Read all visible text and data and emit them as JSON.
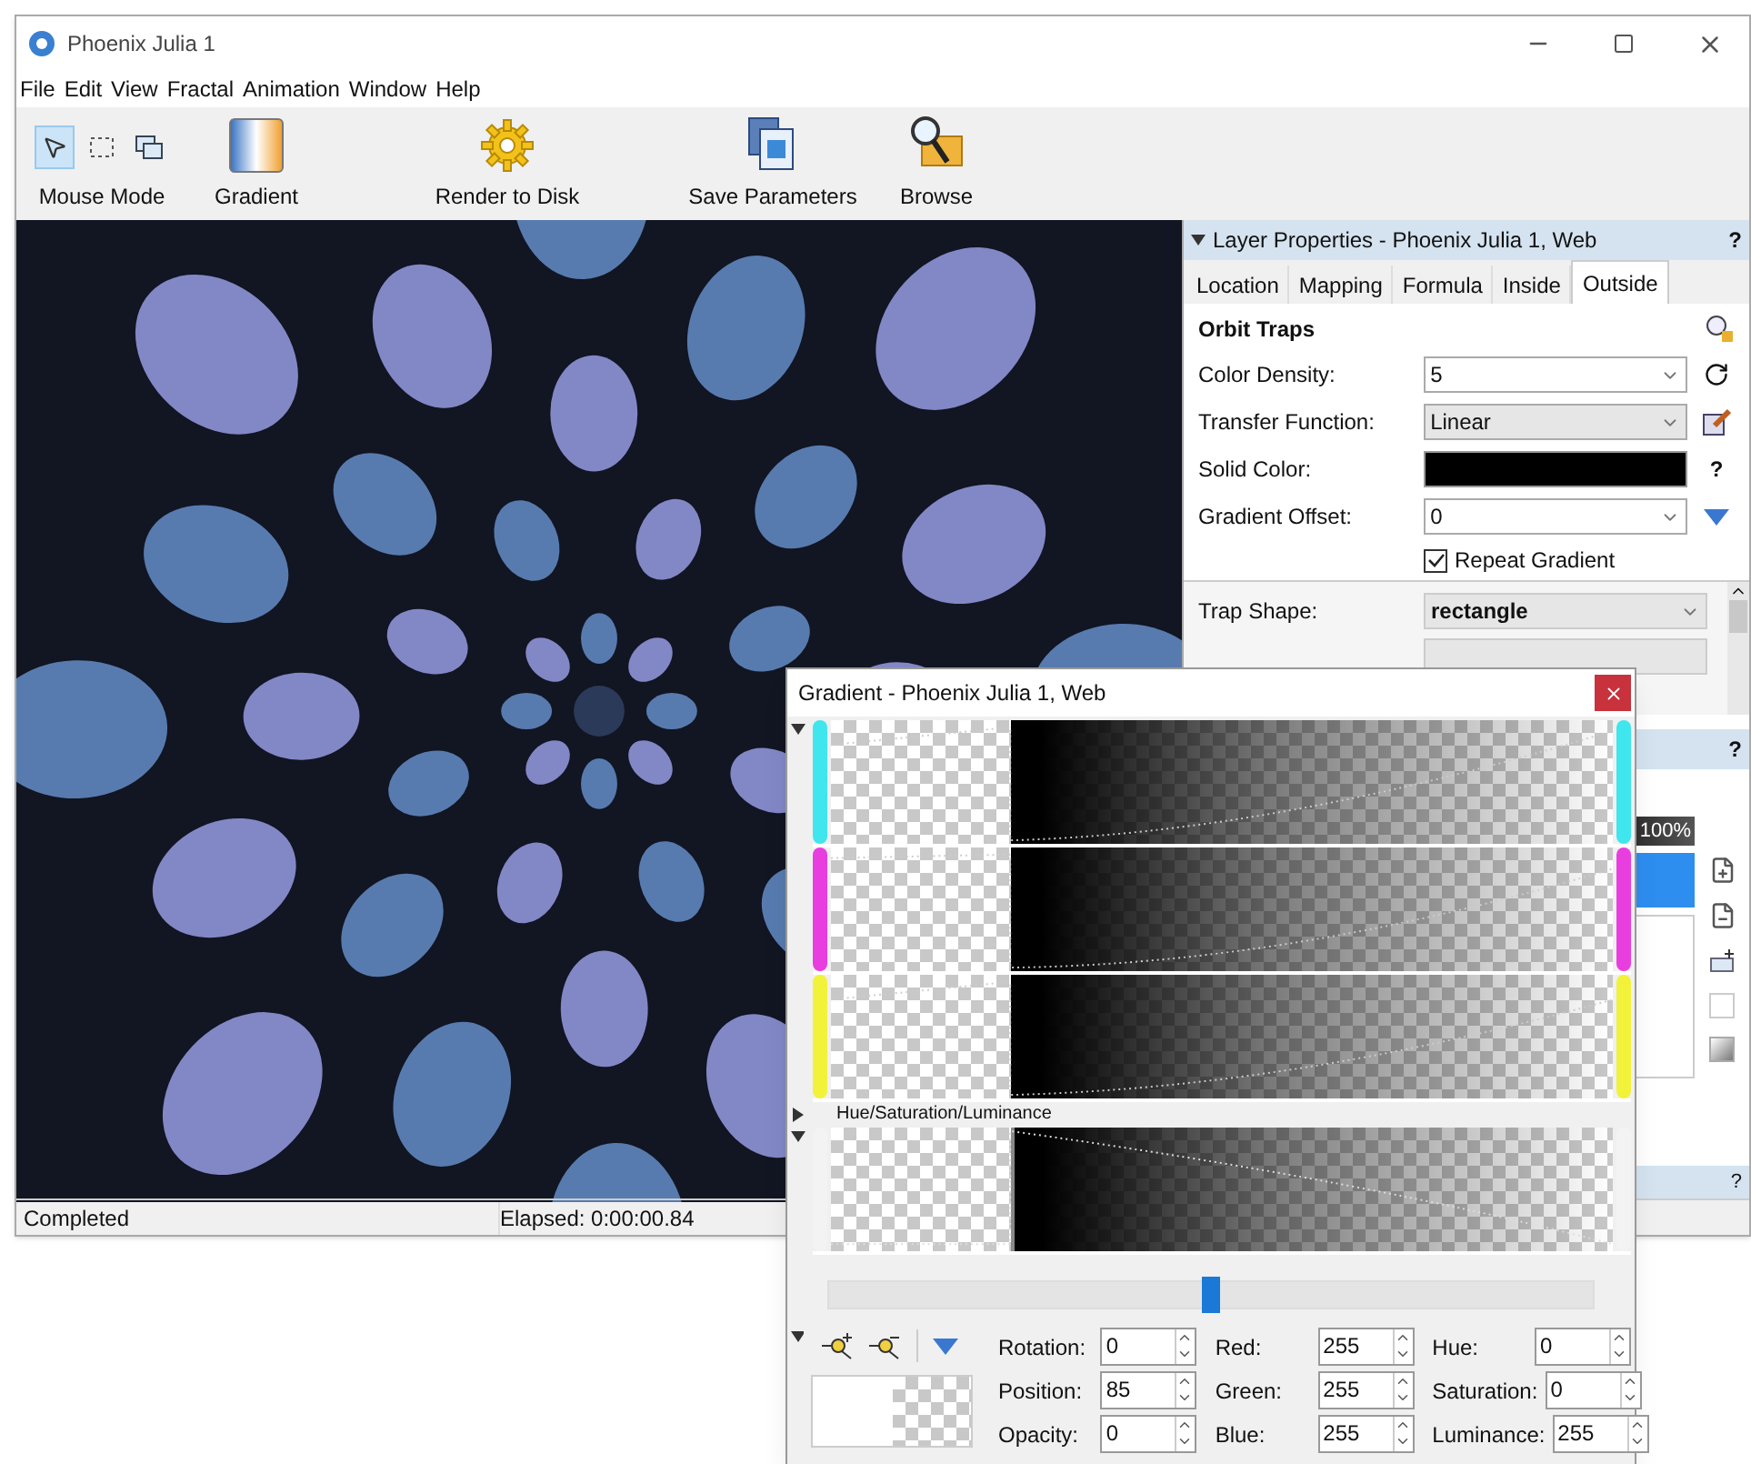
{
  "window": {
    "title": "Phoenix Julia 1"
  },
  "menu": [
    "File",
    "Edit",
    "View",
    "Fractal",
    "Animation",
    "Window",
    "Help"
  ],
  "toolbar": {
    "mouse_mode": {
      "label": "Mouse Mode",
      "tools": [
        {
          "kind": "pointer",
          "selected": true
        },
        {
          "kind": "select",
          "selected": false
        },
        {
          "kind": "window",
          "selected": false
        }
      ]
    },
    "buttons": [
      {
        "label": "Gradient",
        "kind": "gradient"
      },
      {
        "label": "Render to Disk",
        "kind": "gear"
      },
      {
        "label": "Save Parameters",
        "kind": "save"
      },
      {
        "label": "Browse",
        "kind": "browse"
      }
    ]
  },
  "layer_properties": {
    "title": "Layer Properties - Phoenix Julia 1, Web",
    "help": "?",
    "tabs": [
      {
        "label": "Location",
        "selected": false
      },
      {
        "label": "Mapping",
        "selected": false
      },
      {
        "label": "Formula",
        "selected": false
      },
      {
        "label": "Inside",
        "selected": false
      },
      {
        "label": "Outside",
        "selected": true
      }
    ],
    "section": "Orbit Traps",
    "fields": [
      {
        "label": "Color Density:",
        "kind": "combo",
        "value": "5"
      },
      {
        "label": "Transfer Function:",
        "kind": "list",
        "value": "Linear"
      },
      {
        "label": "Solid Color:",
        "kind": "color",
        "color": "#000000",
        "hint": "?"
      },
      {
        "label": "Gradient Offset:",
        "kind": "combo",
        "value": "0"
      }
    ],
    "repeat_gradient": {
      "label": "Repeat Gradient",
      "checked": true
    },
    "trap_shape": {
      "label": "Trap Shape:",
      "value": "rectangle"
    }
  },
  "layers_panel": {
    "help": "?",
    "opacity": "100%",
    "bottom_help": "?"
  },
  "status_bar": {
    "status": "Completed",
    "elapsed": "Elapsed: 0:00:00.84"
  },
  "gradient_dialog": {
    "title": "Gradient - Phoenix Julia 1, Web",
    "channels": [
      {
        "color": "#3fe6ee"
      },
      {
        "color": "#e83ee0"
      },
      {
        "color": "#f2f23a"
      }
    ],
    "hsl_label": "Hue/Saturation/Luminance",
    "slider": {
      "level": 0.5
    },
    "fields": [
      {
        "label": "Rotation:",
        "value": "0"
      },
      {
        "label": "Red:",
        "value": "255"
      },
      {
        "label": "Hue:",
        "value": "0"
      },
      {
        "label": "Position:",
        "value": "85"
      },
      {
        "label": "Green:",
        "value": "255"
      },
      {
        "label": "Saturation:",
        "value": "0"
      },
      {
        "label": "Opacity:",
        "value": "0"
      },
      {
        "label": "Blue:",
        "value": "255"
      },
      {
        "label": "Luminance:",
        "value": "255"
      }
    ]
  }
}
